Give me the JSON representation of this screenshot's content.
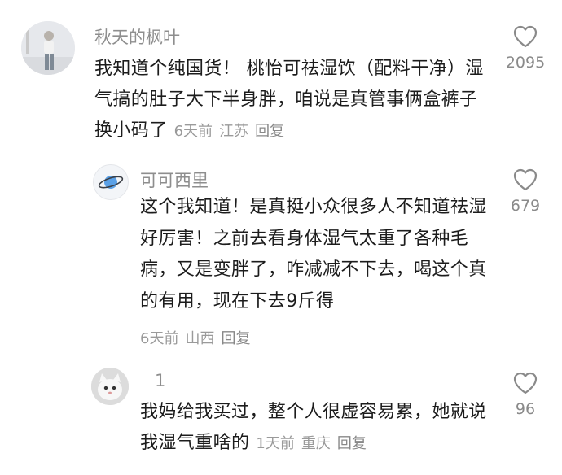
{
  "comments": [
    {
      "username": "秋天的枫叶",
      "text": "我知道个纯国货！ 桃怡可祛湿饮（配料干净）湿气搞的肚子大下半身胖，咱说是真管事俩盒裤子换小码了",
      "time": "6天前",
      "location": "江苏",
      "reply": "回复",
      "likes": "2095",
      "avatar_icon": "person-photo"
    },
    {
      "username": "可可西里",
      "text": "这个我知道！是真挺小众很多人不知道祛湿好厉害！之前去看身体湿气太重了各种毛病，又是变胖了，咋减减不下去，喝这个真的有用，现在下去9斤得",
      "time": "6天前",
      "location": "山西",
      "reply": "回复",
      "likes": "679",
      "avatar_icon": "planet-icon"
    },
    {
      "username": "1",
      "text": "我妈给我买过，整个人很虚容易累，她就说我湿气重啥的",
      "time": "1天前",
      "location": "重庆",
      "reply": "回复",
      "likes": "96",
      "avatar_icon": "cat-photo"
    }
  ],
  "like_icon": "heart-outline-icon",
  "colors": {
    "text": "#1c1c1c",
    "username": "#8e8e8e",
    "meta": "#9a9a9a",
    "icon": "#888888"
  }
}
